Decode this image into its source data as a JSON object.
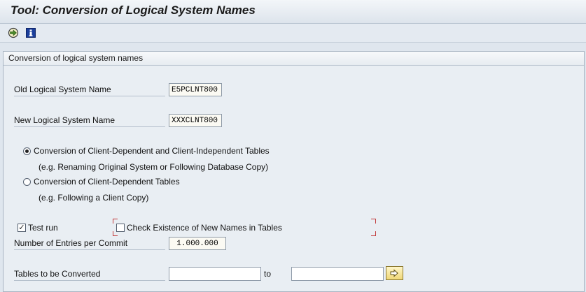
{
  "window": {
    "title": "Tool: Conversion of Logical System Names"
  },
  "panel": {
    "title": "Conversion of logical system names"
  },
  "form": {
    "old_name": {
      "label": "Old Logical System Name",
      "value": "E5PCLNT800"
    },
    "new_name": {
      "label": "New Logical System Name",
      "value": "XXXCLNT800"
    },
    "option_all": {
      "label": "Conversion of Client-Dependent and Client-Independent Tables",
      "hint": "(e.g. Renaming Original System or Following Database Copy)",
      "selected": true
    },
    "option_client": {
      "label": "Conversion of Client-Dependent Tables",
      "hint": "(e.g. Following a Client Copy)",
      "selected": false
    },
    "test_run": {
      "label": "Test run",
      "checked": true,
      "mark": "✓"
    },
    "check_existence": {
      "label": "Check Existence of New Names in Tables",
      "checked": false
    },
    "entries_per_commit": {
      "label": "Number of Entries per Commit",
      "value": "1.000.000"
    },
    "tables": {
      "label": "Tables to be Converted",
      "from": "",
      "to_label": "to",
      "to": ""
    }
  },
  "icons": {
    "execute": "execute-icon",
    "info": "info-icon",
    "multiple_selection": "multiple-selection-icon"
  },
  "colors": {
    "background": "#dfe6ee",
    "field": "#fbfaf3",
    "required_bracket": "#c23b3b",
    "info_icon": "#1b3f9c"
  }
}
